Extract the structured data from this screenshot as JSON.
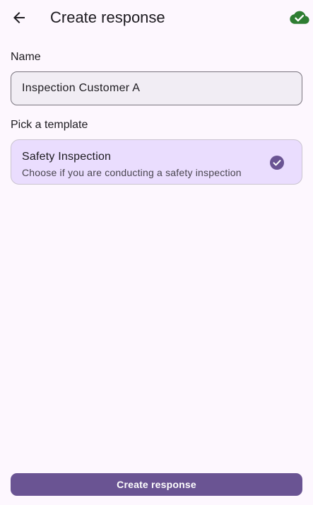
{
  "header": {
    "title": "Create response",
    "back_icon": "arrow-back-icon",
    "sync_icon": "cloud-done-icon",
    "sync_color": "#2e7d32"
  },
  "form": {
    "name_label": "Name",
    "name_value": "Inspection Customer A",
    "template_label": "Pick a template",
    "templates": [
      {
        "title": "Safety Inspection",
        "description": "Choose if you are conducting a safety inspection",
        "selected": true,
        "icon": "check-circle-icon"
      }
    ]
  },
  "actions": {
    "create_label": "Create response"
  },
  "colors": {
    "background": "#fdf7fe",
    "primary": "#6a5493",
    "selected_card": "#eaddfe",
    "input_fill": "#f1edf4"
  }
}
